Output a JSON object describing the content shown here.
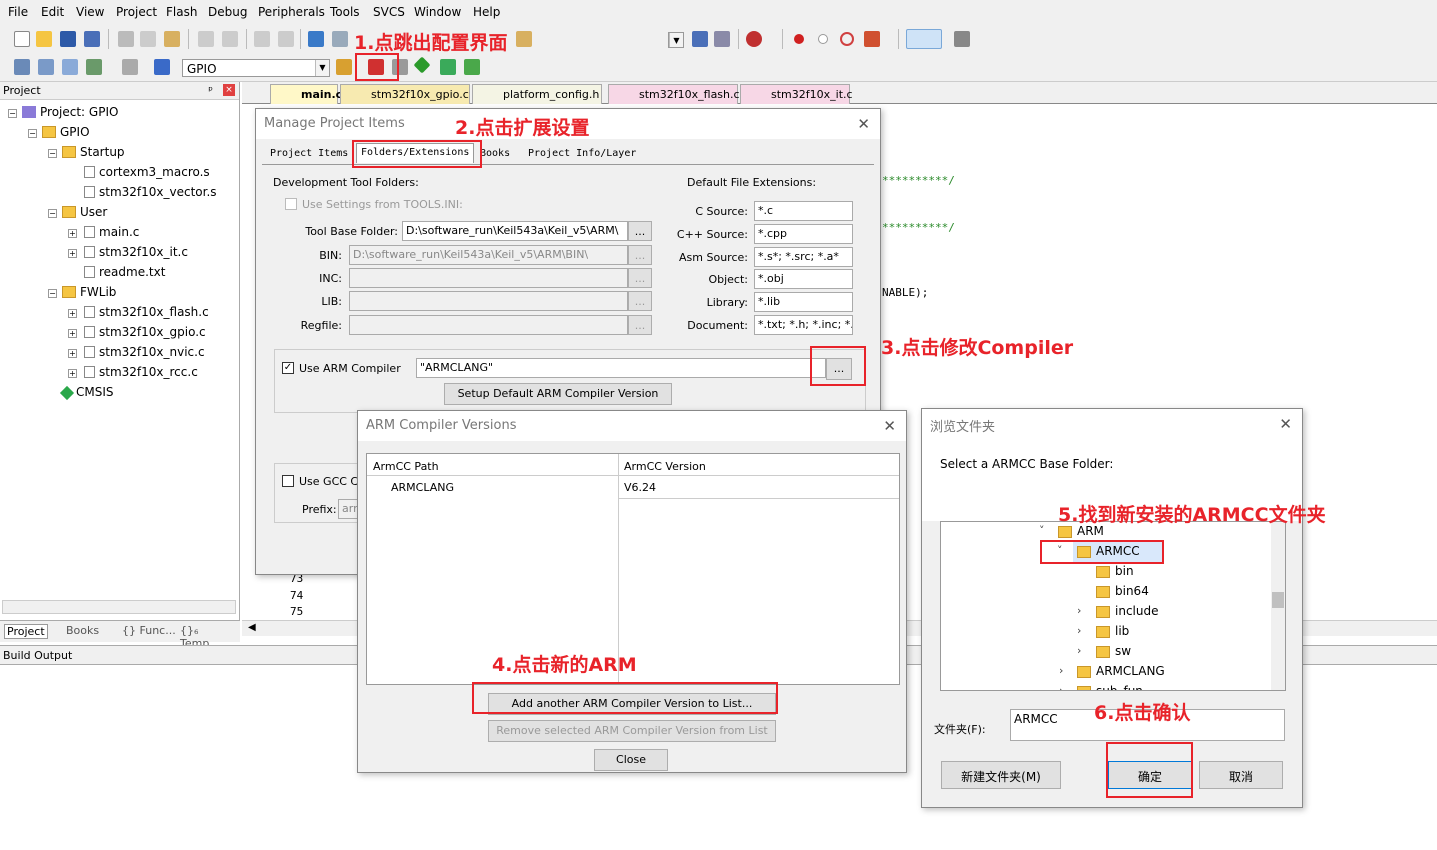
{
  "menu": [
    "File",
    "Edit",
    "View",
    "Project",
    "Flash",
    "Debug",
    "Peripherals",
    "Tools",
    "SVCS",
    "Window",
    "Help"
  ],
  "toolbar": {
    "target_name": "GPIO"
  },
  "annotations": {
    "a1": "1.点跳出配置界面",
    "a2": "2.点击扩展设置",
    "a3": "3.点击修改Compiler",
    "a4": "4.点击新的ARM",
    "a5": "5.找到新安装的ARMCC文件夹",
    "a6": "6.点击确认"
  },
  "project_pane": {
    "title": "Project",
    "root": "Project: GPIO",
    "target": "GPIO",
    "groups": [
      {
        "name": "Startup",
        "files": [
          "cortexm3_macro.s",
          "stm32f10x_vector.s"
        ]
      },
      {
        "name": "User",
        "files": [
          "main.c",
          "stm32f10x_it.c",
          "readme.txt"
        ]
      },
      {
        "name": "FWLib",
        "files": [
          "stm32f10x_flash.c",
          "stm32f10x_gpio.c",
          "stm32f10x_nvic.c",
          "stm32f10x_rcc.c"
        ]
      }
    ],
    "cmsis": "CMSIS",
    "tabs": [
      "Project",
      "Books",
      "{} Func...",
      "{}₆ Temp..."
    ]
  },
  "editor": {
    "tabs": [
      "main.c",
      "stm32f10x_gpio.c",
      "platform_config.h",
      "stm32f10x_flash.c",
      "stm32f10x_it.c"
    ],
    "code_frag1": "**********/",
    "code_frag2": "**********/",
    "code_frag3": "NABLE);",
    "line_numbers": [
      "73",
      "74",
      "75"
    ]
  },
  "build_output": {
    "title": "Build Output"
  },
  "manage_dialog": {
    "title": "Manage Project Items",
    "tabs": [
      "Project Items",
      "Folders/Extensions",
      "Books",
      "Project Info/Layer"
    ],
    "dev_tool_folders": "Development Tool Folders:",
    "use_settings": "Use Settings from TOOLS.INI:",
    "tool_base_label": "Tool Base Folder:",
    "tool_base_value": "D:\\software_run\\Keil543a\\Keil_v5\\ARM\\",
    "bin_label": "BIN:",
    "bin_value": "D:\\software_run\\Keil543a\\Keil_v5\\ARM\\BIN\\",
    "inc_label": "INC:",
    "lib_label": "LIB:",
    "regfile_label": "Regfile:",
    "browse": "...",
    "default_ext": "Default File Extensions:",
    "ext": [
      {
        "label": "C Source:",
        "value": "*.c"
      },
      {
        "label": "C++ Source:",
        "value": "*.cpp"
      },
      {
        "label": "Asm Source:",
        "value": "*.s*; *.src; *.a*"
      },
      {
        "label": "Object:",
        "value": "*.obj"
      },
      {
        "label": "Library:",
        "value": "*.lib"
      },
      {
        "label": "Document:",
        "value": "*.txt; *.h; *.inc; *.md"
      }
    ],
    "use_arm_compiler": "Use ARM Compiler",
    "arm_compiler_value": "\"ARMCLANG\"",
    "setup_default": "Setup Default ARM Compiler Version",
    "use_gcc": "Use GCC Co",
    "prefix_label": "Prefix:",
    "prefix_value": "arm-"
  },
  "armcc_dialog": {
    "title": "ARM Compiler Versions",
    "col_path": "ArmCC Path",
    "col_version": "ArmCC Version",
    "row_path": "ARMCLANG",
    "row_version": "V6.24",
    "add_btn": "Add another ARM Compiler Version to List...",
    "remove_btn": "Remove selected ARM Compiler Version from List",
    "close_btn": "Close"
  },
  "browse_dialog": {
    "title": "浏览文件夹",
    "prompt": "Select a ARMCC Base Folder:",
    "tree": [
      "ARM",
      "ARMCC",
      "bin",
      "bin64",
      "include",
      "lib",
      "sw",
      "ARMCLANG",
      "sub_fun"
    ],
    "folder_label": "文件夹(F):",
    "folder_value": "ARMCC",
    "new_folder": "新建文件夹(M)",
    "ok": "确定",
    "cancel": "取消"
  },
  "colors": {
    "annotation": "#e8232a",
    "tab_active": "#fff8c8",
    "tab_inactive": "#f7d7e6"
  }
}
